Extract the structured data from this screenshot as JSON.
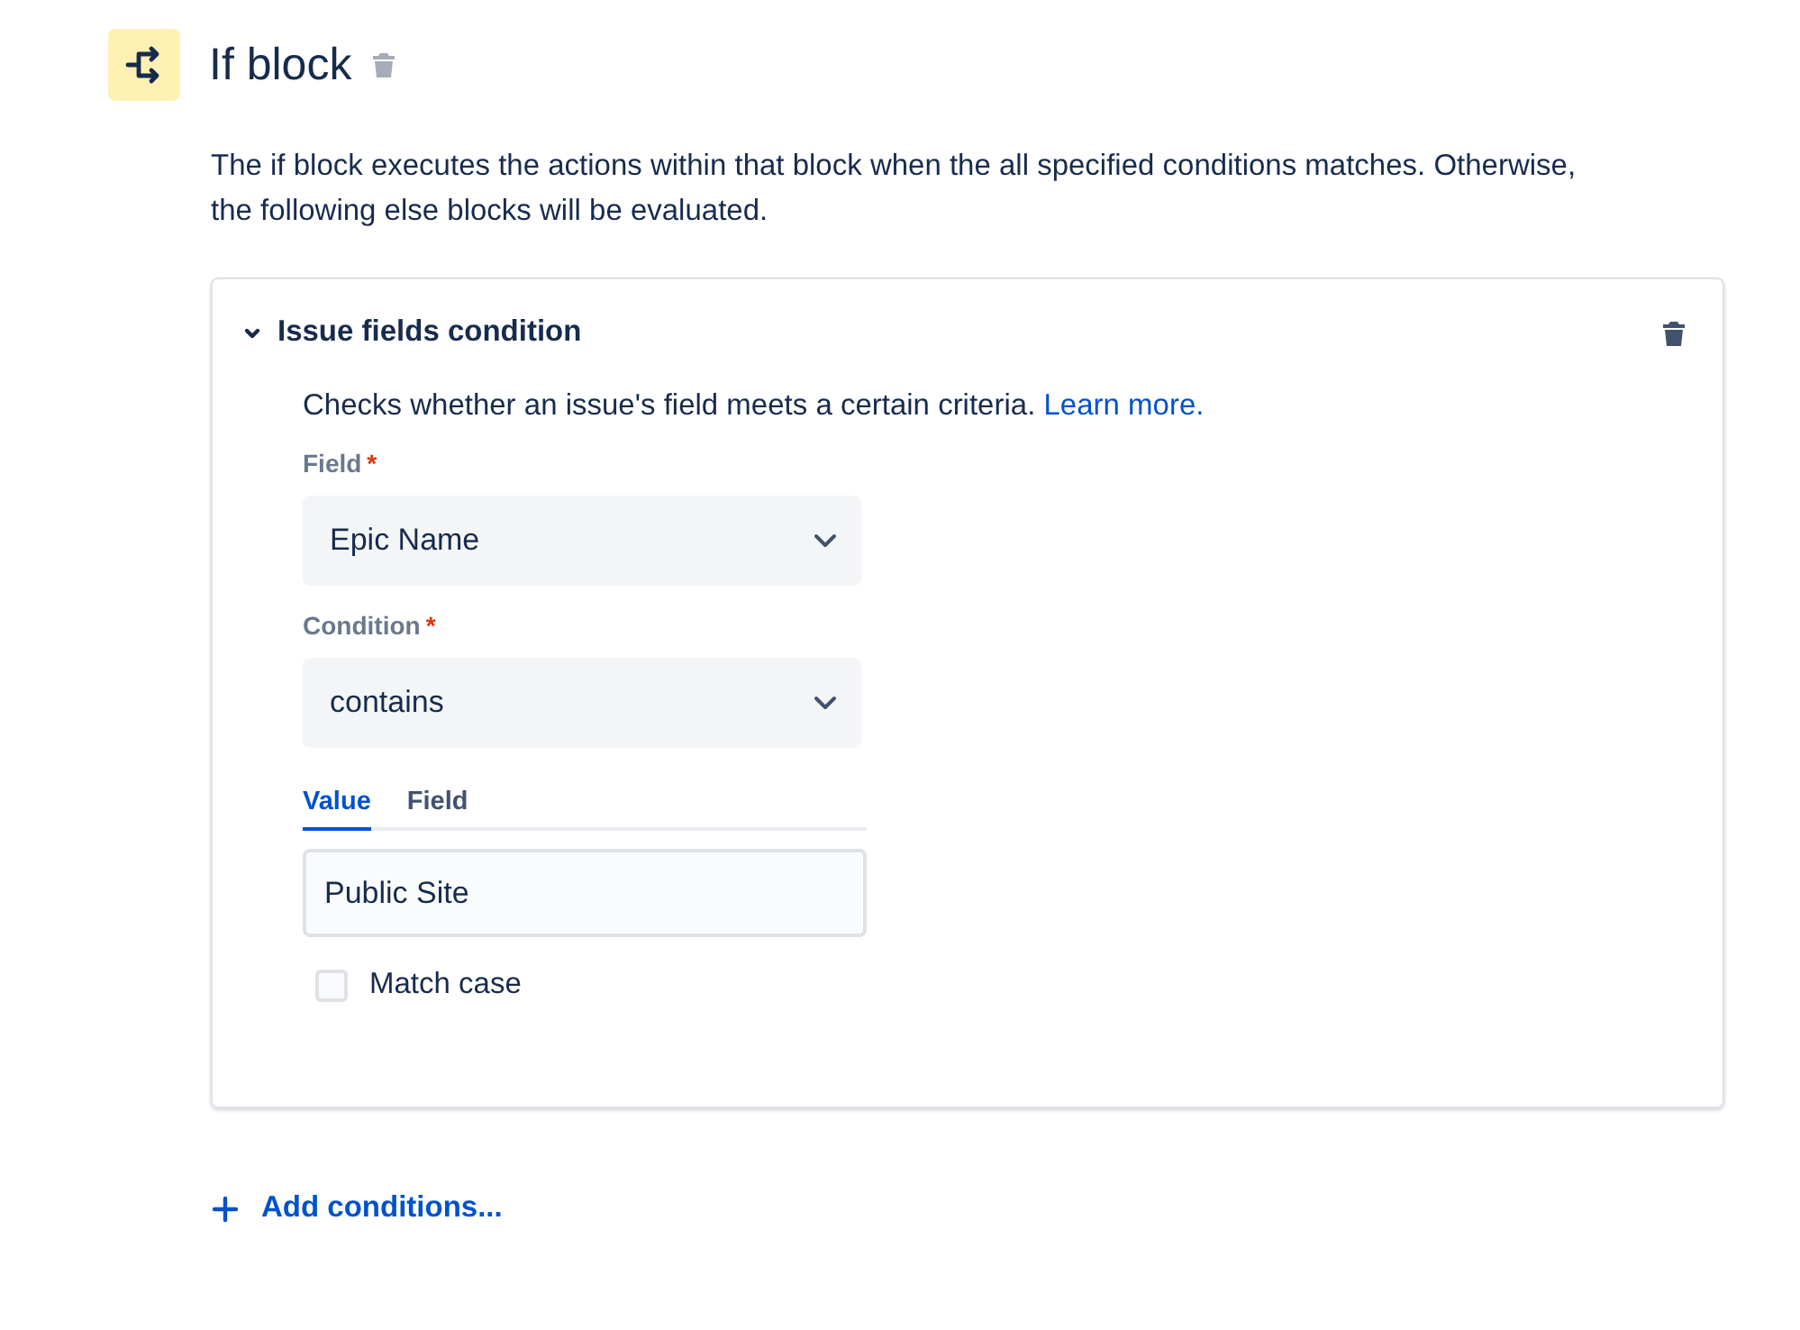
{
  "header": {
    "title": "If block"
  },
  "description": "The if block executes the actions within that block when the all specified conditions matches. Otherwise, the following else blocks will be evaluated.",
  "condition": {
    "title": "Issue fields condition",
    "expanded": true,
    "description": "Checks whether an issue's field meets a certain criteria.",
    "link": "Learn more.",
    "fields": [
      {
        "label": "Field",
        "required_mark": "*",
        "value": "Epic Name"
      },
      {
        "label": "Condition",
        "required_mark": "*",
        "value": "contains"
      }
    ],
    "tabs": [
      {
        "label": "Value",
        "selected": true
      },
      {
        "label": "Field",
        "selected": false
      }
    ],
    "value_input": {
      "value": "Public Site"
    },
    "match_case": {
      "label": "Match case",
      "checked": false
    }
  },
  "add_button": {
    "label": "Add conditions..."
  }
}
